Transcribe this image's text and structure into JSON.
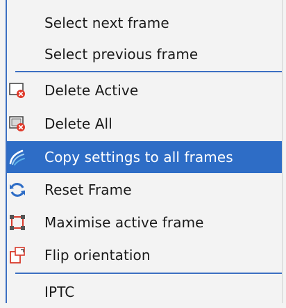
{
  "menu": {
    "items": [
      {
        "label": "Select next frame"
      },
      {
        "label": "Select previous frame"
      },
      {
        "label": "Delete Active",
        "icon": "delete-active-icon"
      },
      {
        "label": "Delete All",
        "icon": "delete-all-icon"
      },
      {
        "label": "Copy settings to all frames",
        "icon": "copy-settings-icon",
        "highlighted": true
      },
      {
        "label": "Reset Frame",
        "icon": "reset-frame-icon"
      },
      {
        "label": "Maximise active frame",
        "icon": "maximise-frame-icon"
      },
      {
        "label": "Flip orientation",
        "icon": "flip-orientation-icon"
      },
      {
        "label": "IPTC"
      }
    ]
  },
  "colors": {
    "highlight": "#2e6dc6",
    "separator": "#3c6fc2",
    "background": "#f3f3f3",
    "delete_badge": "#e03a2b"
  }
}
